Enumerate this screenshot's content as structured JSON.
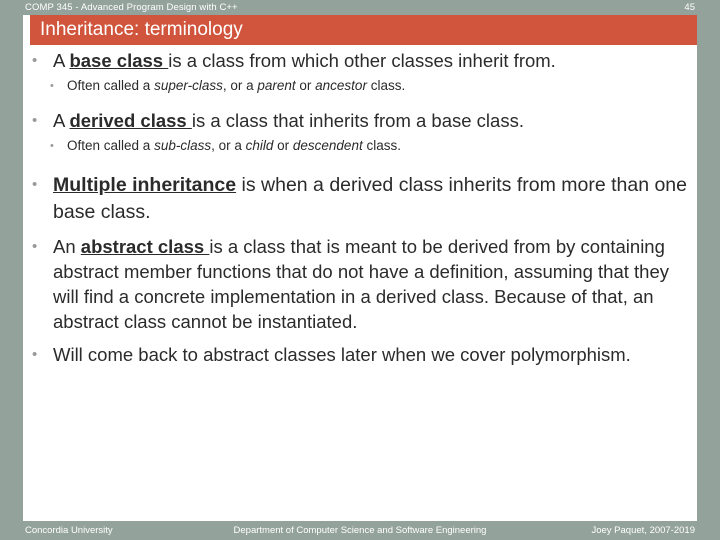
{
  "header": {
    "course_title": "COMP 345 - Advanced Program Design with C++",
    "page_number": "45",
    "band_color": "#94a29c"
  },
  "title": {
    "text": "Inheritance: terminology",
    "bar_color": "#d1543c",
    "text_color": "#ffffff"
  },
  "bullet_marker": "•",
  "content": {
    "b1": {
      "pre": "A ",
      "term": "base class ",
      "post": "is a class from which other classes inherit from."
    },
    "b1s": {
      "p1": "Often called a ",
      "i1": "super-class",
      "p2": ", or a ",
      "i2": "parent",
      "p3": " or ",
      "i3": "ancestor",
      "p4": " class."
    },
    "b2": {
      "pre": "A ",
      "term": "derived class ",
      "post": "is a class that inherits from a base class."
    },
    "b2s": {
      "p1": "Often called a ",
      "i1": "sub-class",
      "p2": ", or a ",
      "i2": "child",
      "p3": " or ",
      "i3": "descendent",
      "p4": " class."
    },
    "b3": {
      "term": "Multiple inheritance",
      "post": " is when a derived class inherits from more than one base class."
    },
    "b4": {
      "pre": "An ",
      "term": "abstract class ",
      "post": "is a class that is meant to be derived from by containing abstract member functions that do not have a definition, assuming that they will find a concrete implementation in a derived class. Because of that, an abstract class cannot be instantiated."
    },
    "b5": {
      "text": "Will come back to abstract classes later when we cover polymorphism."
    }
  },
  "footer": {
    "left": "Concordia University",
    "center": "Department of Computer Science and Software Engineering",
    "right": "Joey Paquet, 2007-2019",
    "band_color": "#94a29c"
  }
}
